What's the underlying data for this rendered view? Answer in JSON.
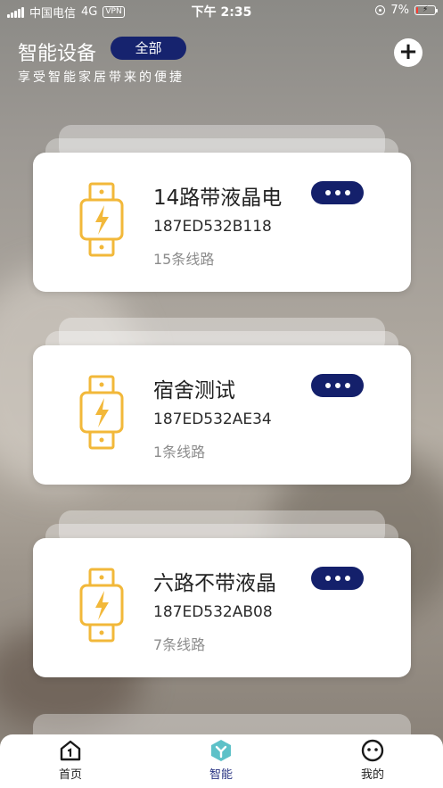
{
  "status_bar": {
    "carrier": "中国电信",
    "network": "4G",
    "vpn": "VPN",
    "time": "下午 2:35",
    "battery_percent": "7%",
    "battery_level": 0.07
  },
  "header": {
    "title": "智能设备",
    "filter_chip": "全部",
    "subtitle": "享受智能家居带来的便捷",
    "add_button": "+"
  },
  "devices": [
    {
      "name": "14路带液晶电",
      "id": "187ED532B118",
      "lines": "15条线路"
    },
    {
      "name": "宿舍测试",
      "id": "187ED532AE34",
      "lines": "1条线路"
    },
    {
      "name": "六路不带液晶",
      "id": "187ED532AB08",
      "lines": "7条线路"
    }
  ],
  "tabbar": {
    "home": "首页",
    "smart": "智能",
    "mine": "我的"
  },
  "colors": {
    "accent": "#14206b",
    "icon_yellow": "#f2b83a",
    "active_tab": "#2a3483",
    "smart_icon": "#5ec1c8"
  }
}
